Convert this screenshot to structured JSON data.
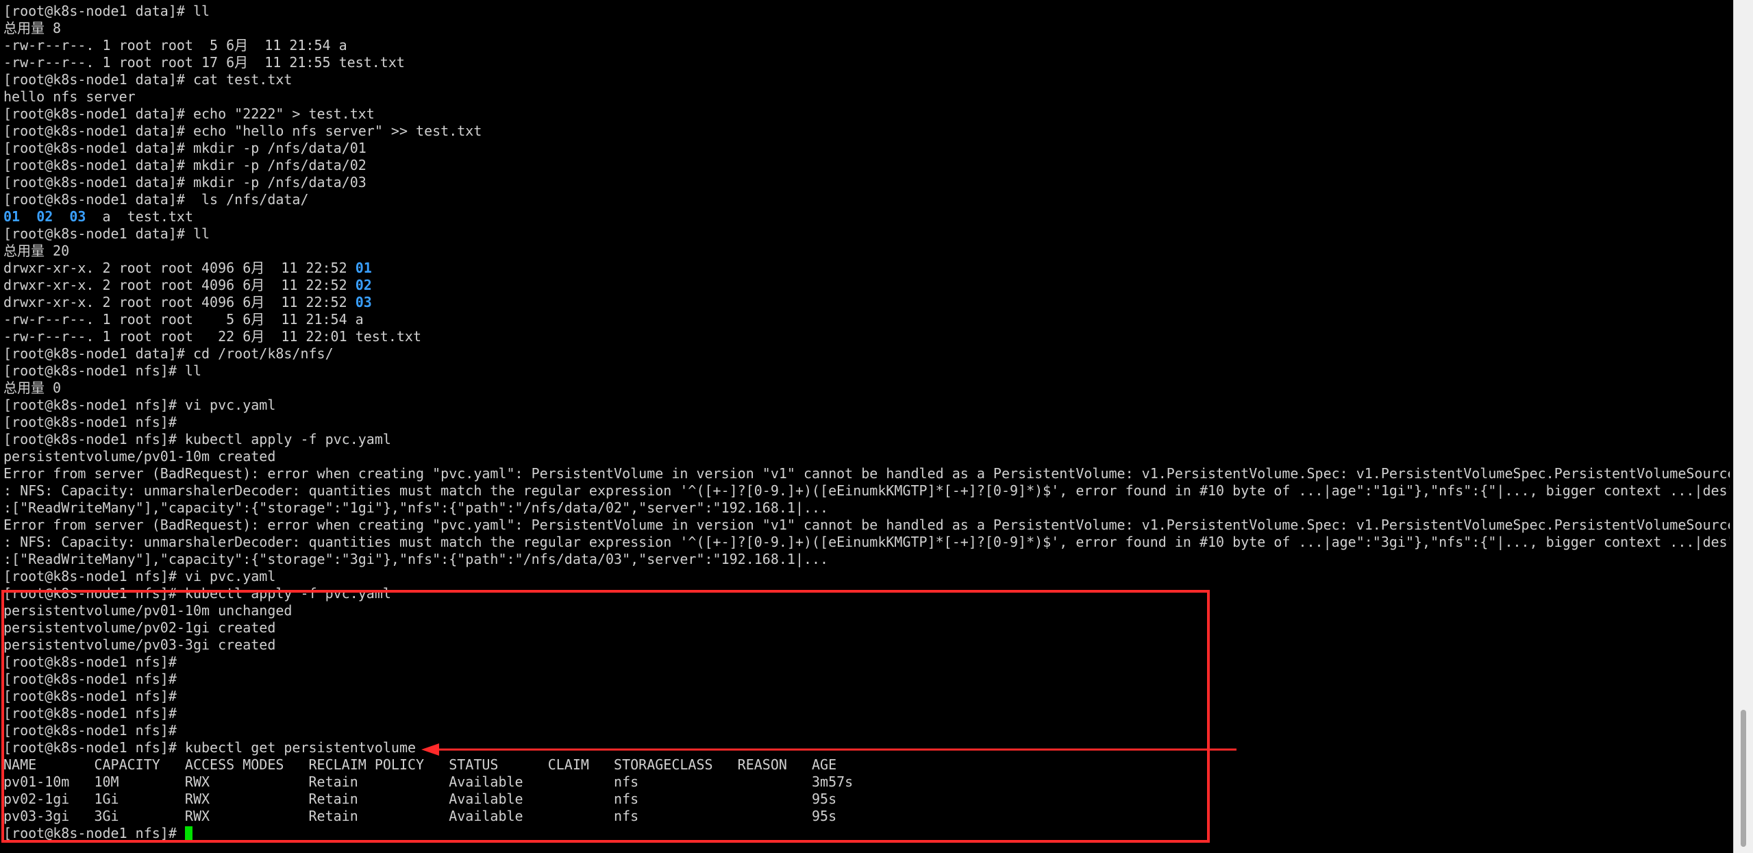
{
  "window": {
    "background_color": "#000000",
    "foreground_color": "#d0d0d0",
    "directory_color": "#3aa0ff",
    "annotation_color": "#ff2a2a",
    "cursor_color": "#00e000"
  },
  "lines": [
    [
      {
        "t": "[root@k8s-node1 data]# ll"
      }
    ],
    [
      {
        "t": "总用量 8"
      }
    ],
    [
      {
        "t": "-rw-r--r--. 1 root root  5 6月  11 21:54 a"
      }
    ],
    [
      {
        "t": "-rw-r--r--. 1 root root 17 6月  11 21:55 test.txt"
      }
    ],
    [
      {
        "t": "[root@k8s-node1 data]# cat test.txt"
      }
    ],
    [
      {
        "t": "hello nfs server"
      }
    ],
    [
      {
        "t": "[root@k8s-node1 data]# echo \"2222\" > test.txt"
      }
    ],
    [
      {
        "t": "[root@k8s-node1 data]# echo \"hello nfs server\" >> test.txt"
      }
    ],
    [
      {
        "t": "[root@k8s-node1 data]# mkdir -p /nfs/data/01"
      }
    ],
    [
      {
        "t": "[root@k8s-node1 data]# mkdir -p /nfs/data/02"
      }
    ],
    [
      {
        "t": "[root@k8s-node1 data]# mkdir -p /nfs/data/03"
      }
    ],
    [
      {
        "t": "[root@k8s-node1 data]#  ls /nfs/data/"
      }
    ],
    [
      {
        "t": "01",
        "c": "dir"
      },
      {
        "t": "  "
      },
      {
        "t": "02",
        "c": "dir"
      },
      {
        "t": "  "
      },
      {
        "t": "03",
        "c": "dir"
      },
      {
        "t": "  a  test.txt"
      }
    ],
    [
      {
        "t": "[root@k8s-node1 data]# ll"
      }
    ],
    [
      {
        "t": "总用量 20"
      }
    ],
    [
      {
        "t": "drwxr-xr-x. 2 root root 4096 6月  11 22:52 "
      },
      {
        "t": "01",
        "c": "dir"
      }
    ],
    [
      {
        "t": "drwxr-xr-x. 2 root root 4096 6月  11 22:52 "
      },
      {
        "t": "02",
        "c": "dir"
      }
    ],
    [
      {
        "t": "drwxr-xr-x. 2 root root 4096 6月  11 22:52 "
      },
      {
        "t": "03",
        "c": "dir"
      }
    ],
    [
      {
        "t": "-rw-r--r--. 1 root root    5 6月  11 21:54 a"
      }
    ],
    [
      {
        "t": "-rw-r--r--. 1 root root   22 6月  11 22:01 test.txt"
      }
    ],
    [
      {
        "t": "[root@k8s-node1 data]# cd /root/k8s/nfs/"
      }
    ],
    [
      {
        "t": "[root@k8s-node1 nfs]# ll"
      }
    ],
    [
      {
        "t": "总用量 0"
      }
    ],
    [
      {
        "t": "[root@k8s-node1 nfs]# vi pvc.yaml"
      }
    ],
    [
      {
        "t": "[root@k8s-node1 nfs]#"
      }
    ],
    [
      {
        "t": "[root@k8s-node1 nfs]# kubectl apply -f pvc.yaml"
      }
    ],
    [
      {
        "t": "persistentvolume/pv01-10m created"
      }
    ],
    [
      {
        "t": "Error from server (BadRequest): error when creating \"pvc.yaml\": PersistentVolume in version \"v1\" cannot be handled as a PersistentVolume: v1.PersistentVolume.Spec: v1.PersistentVolumeSpec.PersistentVolumeSource"
      }
    ],
    [
      {
        "t": ": NFS: Capacity: unmarshalerDecoder: quantities must match the regular expression '^([+-]?[0-9.]+)([eEinumkKMGTP]*[-+]?[0-9]*)$', error found in #10 byte of ...|age\":\"1gi\"},\"nfs\":{\"|..., bigger context ...|des\""
      }
    ],
    [
      {
        "t": ":[\"ReadWriteMany\"],\"capacity\":{\"storage\":\"1gi\"},\"nfs\":{\"path\":\"/nfs/data/02\",\"server\":\"192.168.1|..."
      }
    ],
    [
      {
        "t": "Error from server (BadRequest): error when creating \"pvc.yaml\": PersistentVolume in version \"v1\" cannot be handled as a PersistentVolume: v1.PersistentVolume.Spec: v1.PersistentVolumeSpec.PersistentVolumeSource"
      }
    ],
    [
      {
        "t": ": NFS: Capacity: unmarshalerDecoder: quantities must match the regular expression '^([+-]?[0-9.]+)([eEinumkKMGTP]*[-+]?[0-9]*)$', error found in #10 byte of ...|age\":\"3gi\"},\"nfs\":{\"|..., bigger context ...|des\""
      }
    ],
    [
      {
        "t": ":[\"ReadWriteMany\"],\"capacity\":{\"storage\":\"3gi\"},\"nfs\":{\"path\":\"/nfs/data/03\",\"server\":\"192.168.1|..."
      }
    ],
    [
      {
        "t": "[root@k8s-node1 nfs]# vi pvc.yaml"
      }
    ],
    [
      {
        "t": "[root@k8s-node1 nfs]# kubectl apply -f pvc.yaml"
      }
    ],
    [
      {
        "t": "persistentvolume/pv01-10m unchanged"
      }
    ],
    [
      {
        "t": "persistentvolume/pv02-1gi created"
      }
    ],
    [
      {
        "t": "persistentvolume/pv03-3gi created"
      }
    ],
    [
      {
        "t": "[root@k8s-node1 nfs]#"
      }
    ],
    [
      {
        "t": "[root@k8s-node1 nfs]#"
      }
    ],
    [
      {
        "t": "[root@k8s-node1 nfs]#"
      }
    ],
    [
      {
        "t": "[root@k8s-node1 nfs]#"
      }
    ],
    [
      {
        "t": "[root@k8s-node1 nfs]#"
      }
    ],
    [
      {
        "t": "[root@k8s-node1 nfs]# kubectl get persistentvolume"
      }
    ],
    [
      {
        "t": "NAME       CAPACITY   ACCESS MODES   RECLAIM POLICY   STATUS      CLAIM   STORAGECLASS   REASON   AGE"
      }
    ],
    [
      {
        "t": "pv01-10m   10M        RWX            Retain           Available           nfs                     3m57s"
      }
    ],
    [
      {
        "t": "pv02-1gi   1Gi        RWX            Retain           Available           nfs                     95s"
      }
    ],
    [
      {
        "t": "pv03-3gi   3Gi        RWX            Retain           Available           nfs                     95s"
      }
    ],
    [
      {
        "t": "[root@k8s-node1 nfs]# "
      },
      {
        "c": "cursor"
      }
    ]
  ]
}
